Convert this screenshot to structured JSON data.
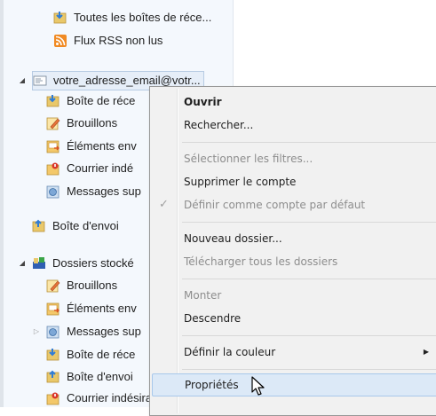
{
  "tree": {
    "items": [
      {
        "label": "Toutes les boîtes de réce...",
        "icon": "unified-inbox-icon"
      },
      {
        "label": "Flux RSS non lus",
        "icon": "rss-icon"
      },
      {
        "label": "votre_adresse_email@votr...",
        "icon": "email-account-icon"
      },
      {
        "label": "Boîte de réce",
        "icon": "inbox-icon"
      },
      {
        "label": "Brouillons",
        "icon": "drafts-icon"
      },
      {
        "label": "Éléments env",
        "icon": "sent-icon"
      },
      {
        "label": "Courrier indé",
        "icon": "junk-icon"
      },
      {
        "label": "Messages sup",
        "icon": "deleted-icon"
      },
      {
        "label": "Boîte d'envoi",
        "icon": "outbox-icon"
      },
      {
        "label": "Dossiers stocké",
        "icon": "local-folders-icon"
      },
      {
        "label": "Brouillons",
        "icon": "drafts-icon"
      },
      {
        "label": "Éléments env",
        "icon": "sent-icon"
      },
      {
        "label": "Messages sup",
        "icon": "deleted-icon"
      },
      {
        "label": "Boîte de réce",
        "icon": "inbox-icon"
      },
      {
        "label": "Boîte d'envoi",
        "icon": "outbox-icon"
      },
      {
        "label": "Courrier indésirable",
        "icon": "junk-folder-icon"
      }
    ]
  },
  "context_menu": {
    "items": [
      {
        "label": "Ouvrir"
      },
      {
        "label": "Rechercher..."
      },
      {
        "label": "Sélectionner les filtres..."
      },
      {
        "label": "Supprimer le compte"
      },
      {
        "label": "Définir comme compte par défaut"
      },
      {
        "label": "Nouveau dossier..."
      },
      {
        "label": "Télécharger tous les dossiers"
      },
      {
        "label": "Monter"
      },
      {
        "label": "Descendre"
      },
      {
        "label": "Définir la couleur"
      },
      {
        "label": "Propriétés"
      }
    ],
    "checkmark": "✓",
    "submenu_arrow": "▶"
  },
  "tree_toggles": {
    "expanded": "◢",
    "collapsed": "▷"
  },
  "colors": {
    "hover_bg": "#dce9f7",
    "menu_bg": "#f1f1f1",
    "tree_bg": "#f4f8fd"
  }
}
